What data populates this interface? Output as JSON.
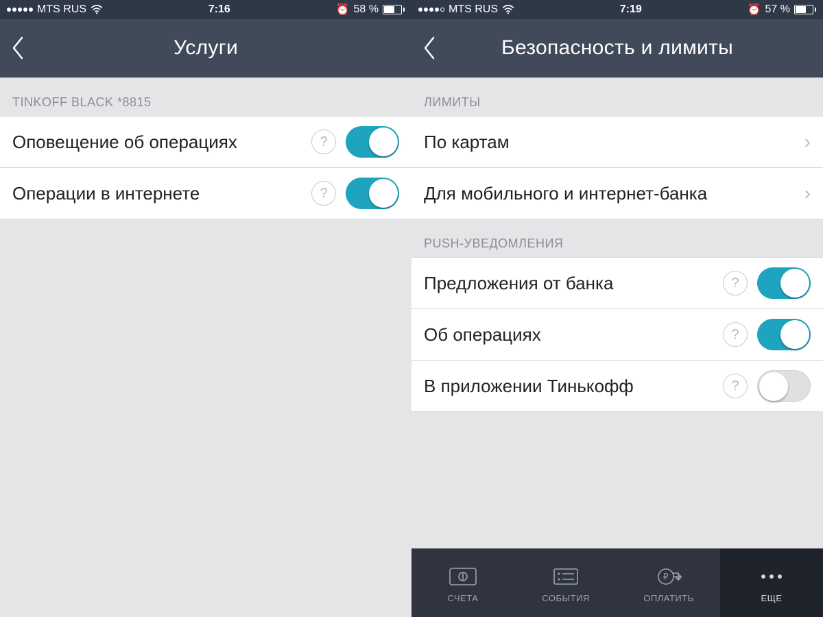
{
  "colors": {
    "nav": "#414a59",
    "status": "#2f3846",
    "accent": "#1fa4bf",
    "tabbar": "#2f3440",
    "tabactive": "#1f232c"
  },
  "left": {
    "status": {
      "carrier": "MTS RUS",
      "time": "7:16",
      "battery_text": "58 %",
      "battery_level": 58,
      "alarm": true,
      "signal": 5
    },
    "nav_title": "Услуги",
    "section_header": "TINKOFF BLACK *8815",
    "rows": [
      {
        "label": "Оповещение об операциях",
        "help": "?",
        "toggle": true
      },
      {
        "label": "Операции в интернете",
        "help": "?",
        "toggle": true
      }
    ]
  },
  "right": {
    "status": {
      "carrier": "MTS RUS",
      "time": "7:19",
      "battery_text": "57 %",
      "battery_level": 57,
      "alarm": true,
      "signal": 4
    },
    "nav_title": "Безопасность и лимиты",
    "section1_header": "ЛИМИТЫ",
    "section1_rows": [
      {
        "label": "По картам"
      },
      {
        "label": "Для мобильного и интернет-банка"
      }
    ],
    "section2_header": "PUSH-УВЕДОМЛЕНИЯ",
    "section2_rows": [
      {
        "label": "Предложения от банка",
        "help": "?",
        "toggle": true
      },
      {
        "label": "Об операциях",
        "help": "?",
        "toggle": true
      },
      {
        "label": "В приложении Тинькофф",
        "help": "?",
        "toggle": false
      }
    ],
    "tabs": [
      {
        "label": "СЧЕТА"
      },
      {
        "label": "СОБЫТИЯ"
      },
      {
        "label": "ОПЛАТИТЬ"
      },
      {
        "label": "ЕЩЕ",
        "active": true
      }
    ]
  }
}
